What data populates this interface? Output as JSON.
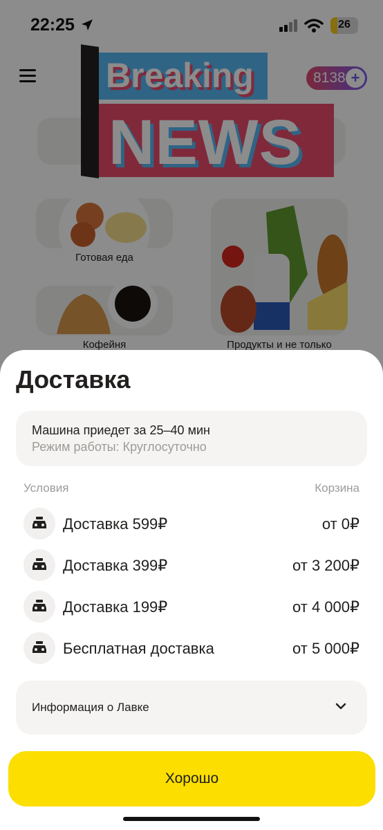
{
  "status_bar": {
    "time": "22:25",
    "battery": "26",
    "battery_level": 0.26
  },
  "header": {
    "points": "8138",
    "points_plus": "+"
  },
  "overlay_banner": {
    "line1": "Breaking",
    "line2": "NEWS"
  },
  "categories": [
    {
      "label": "Готовая еда"
    },
    {
      "label": "Кофейня"
    },
    {
      "label": "Продукты и не только"
    }
  ],
  "sheet": {
    "title": "Доставка",
    "info_main": "Машина приедет за 25–40 мин",
    "info_sub": "Режим работы: Круглосуточно",
    "col_conditions": "Условия",
    "col_cart": "Корзина",
    "rows": [
      {
        "label": "Доставка 599₽",
        "price": "от 0₽",
        "icon": "car-icon"
      },
      {
        "label": "Доставка 399₽",
        "price": "от 3 200₽",
        "icon": "car-icon"
      },
      {
        "label": "Доставка 199₽",
        "price": "от 4 000₽",
        "icon": "car-icon"
      },
      {
        "label": "Бесплатная доставка",
        "price": "от 5 000₽",
        "icon": "car-icon"
      }
    ],
    "lavka_info": "Информация о Лавке",
    "ok_button": "Хорошо"
  },
  "colors": {
    "accent_yellow": "#fcde00",
    "badge_gradient_start": "#e0496b",
    "badge_gradient_end": "#7b5cf0",
    "news_blue": "#56b6f2",
    "news_pink": "#e94b6c"
  }
}
